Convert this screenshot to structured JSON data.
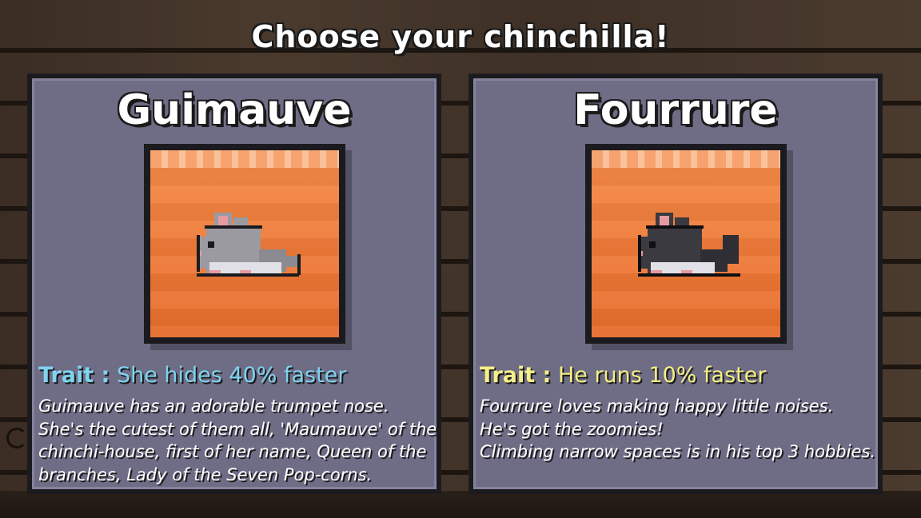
{
  "screen_title": "Choose your chinchilla!",
  "cards": [
    {
      "name": "Guimauve",
      "trait_label": "Trait :",
      "trait_value": "She hides 40% faster",
      "trait_color": "#7fd3ee",
      "fur_color": "#9a9aa0",
      "description": [
        "Guimauve has an adorable trumpet nose.",
        "She's the cutest of them all, 'Maumauve' of the",
        "chinchi-house, first of her name, Queen of the",
        "branches, Lady of the Seven Pop-corns."
      ]
    },
    {
      "name": "Fourrure",
      "trait_label": "Trait :",
      "trait_value": "He runs 10% faster",
      "trait_color": "#f4ef86",
      "fur_color": "#3a3a40",
      "description": [
        "Fourrure loves making happy little noises.",
        "He's got the zoomies!",
        "Climbing narrow spaces is in his top 3 hobbies."
      ]
    }
  ]
}
